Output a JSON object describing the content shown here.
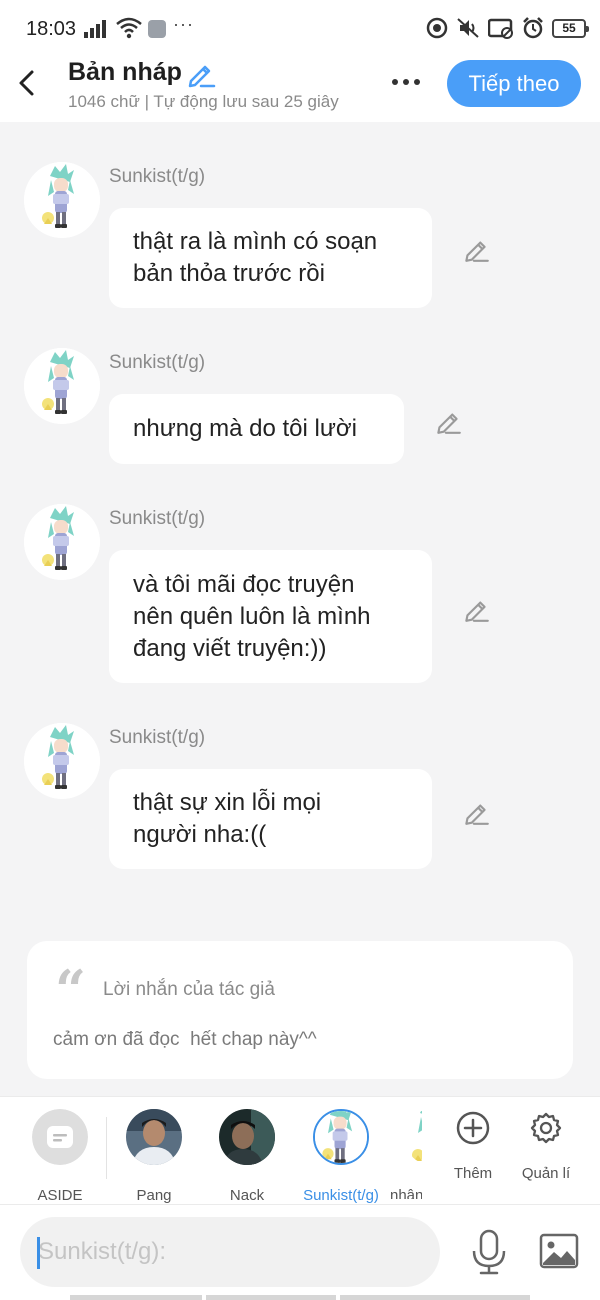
{
  "status_bar": {
    "time": "18:03",
    "battery": "55"
  },
  "header": {
    "title": "Bản nháp",
    "subtitle": "1046 chữ | Tự động lưu sau 25 giây",
    "next_button": "Tiếp theo"
  },
  "messages": [
    {
      "sender": "Sunkist(t/g)",
      "lines": [
        "thật ra là mình có soạn",
        "bản thỏa trước rồi"
      ]
    },
    {
      "sender": "Sunkist(t/g)",
      "lines": [
        "nhưng mà do tôi lười"
      ]
    },
    {
      "sender": "Sunkist(t/g)",
      "lines": [
        "và tôi mãi đọc truyện",
        "nên quên luôn là mình",
        "đang viết truyện:))"
      ]
    },
    {
      "sender": "Sunkist(t/g)",
      "lines": [
        "thật sự xin lỗi mọi",
        "người nha:(("
      ]
    }
  ],
  "author_note": {
    "label": "Lời nhắn của tác giả",
    "text": "cảm ơn đã đọc  hết chap này^^"
  },
  "characters": [
    {
      "name": "ASIDE"
    },
    {
      "name": "Pang"
    },
    {
      "name": "Nack"
    },
    {
      "name": "Sunkist(t/g)",
      "selected": true
    },
    {
      "name": "nhân"
    }
  ],
  "tools": {
    "add": "Thêm",
    "manage": "Quản lí"
  },
  "composer": {
    "placeholder": "Sunkist(t/g):"
  },
  "colors": {
    "accent": "#4a9ef8",
    "active_label": "#3a8fe6",
    "background": "#f4f4f5"
  }
}
